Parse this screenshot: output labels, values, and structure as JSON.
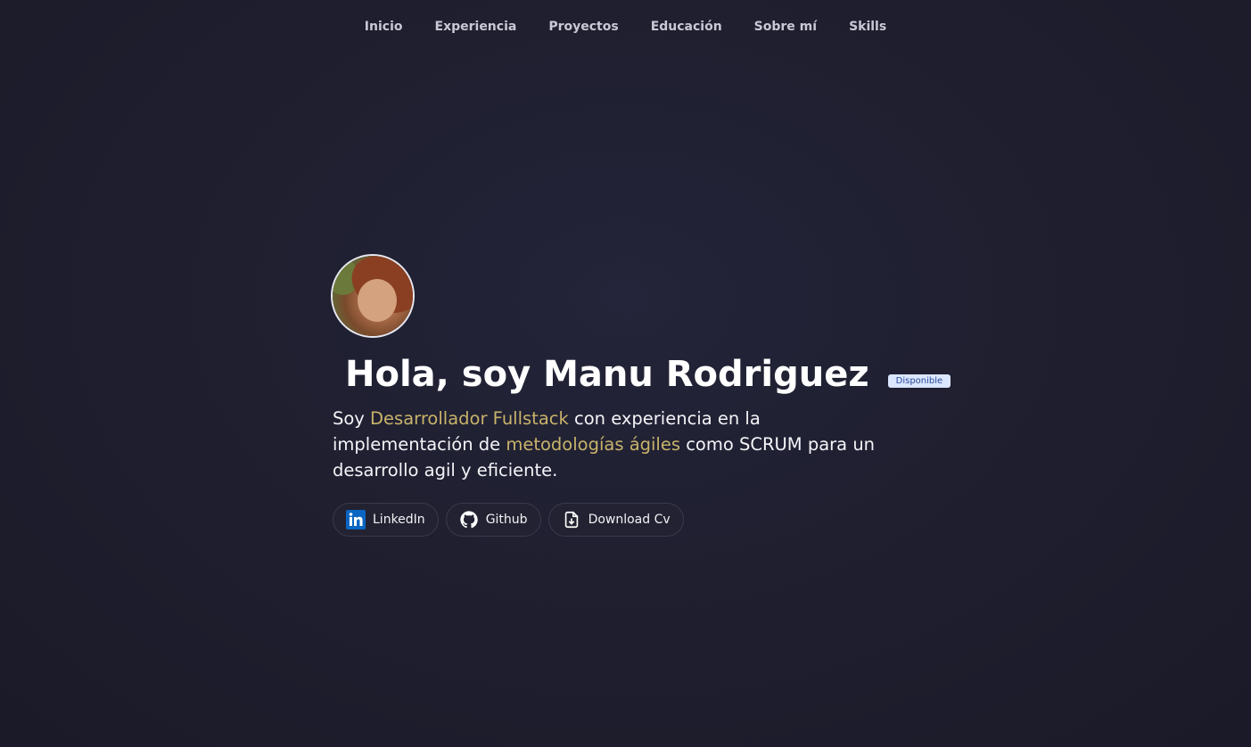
{
  "nav": {
    "items": [
      "Inicio",
      "Experiencia",
      "Proyectos",
      "Educación",
      "Sobre mí",
      "Skills"
    ]
  },
  "hero": {
    "title": "Hola, soy Manu Rodriguez",
    "badge": "Disponible",
    "description": {
      "part1": "Soy ",
      "highlight1": "Desarrollador Fullstack",
      "part2": " con experiencia en la implementación de ",
      "highlight2": "metodologías ágiles",
      "part3": " como SCRUM para un desarrollo agil y eficiente."
    },
    "buttons": {
      "linkedin": "LinkedIn",
      "github": "Github",
      "cv": "Download Cv"
    }
  },
  "colors": {
    "background": "#1f1f30",
    "highlight": "#c8b36a",
    "badge_bg": "#dbe6ff",
    "badge_text": "#2a4a9a",
    "linkedin": "#0a66c2"
  },
  "icons": {
    "linkedin": "linkedin-icon",
    "github": "github-icon",
    "cv": "file-download-icon"
  }
}
